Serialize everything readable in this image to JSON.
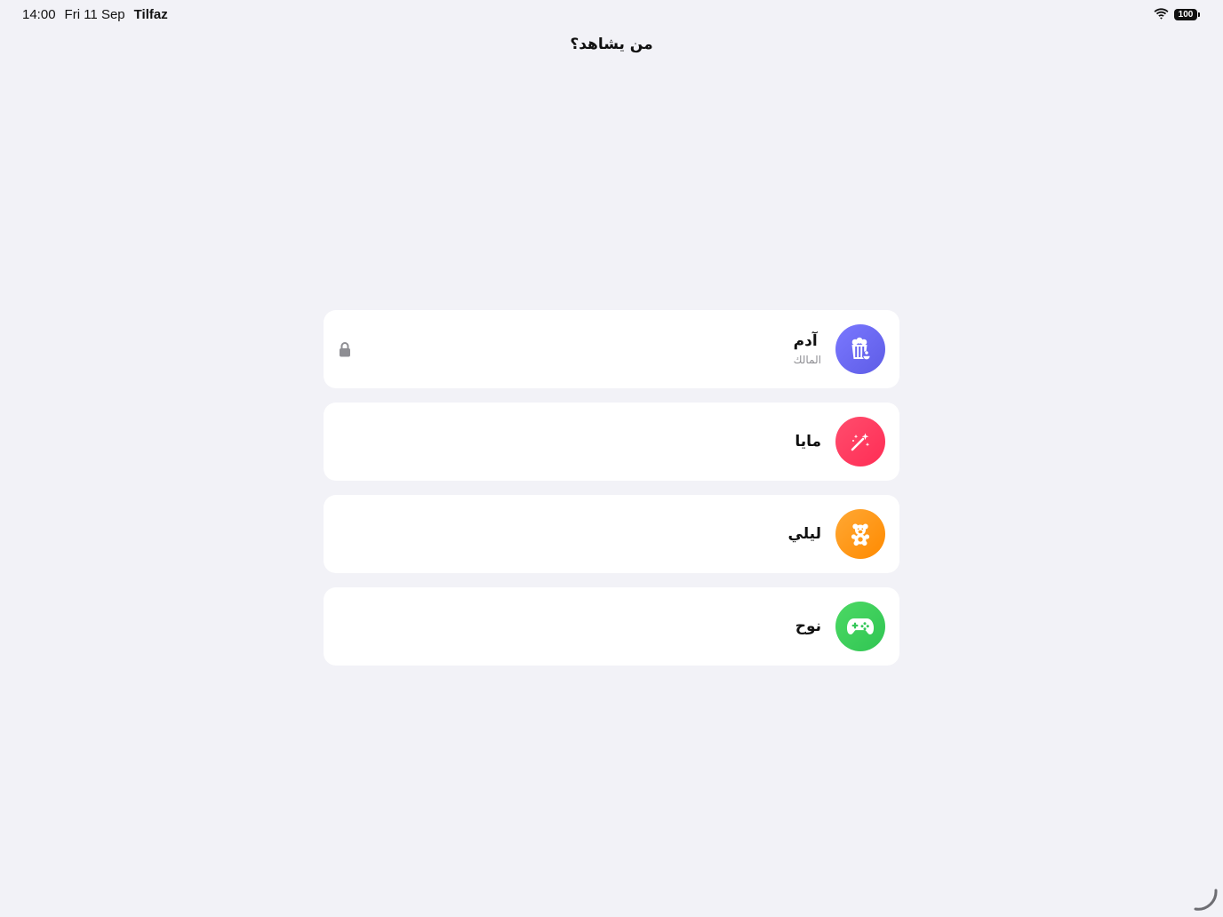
{
  "status_bar": {
    "time": "14:00",
    "date": "Fri 11 Sep",
    "app_name": "Tilfaz",
    "battery_level": "100"
  },
  "header": {
    "title": "من يشاهد؟"
  },
  "profiles": [
    {
      "name": "آدم",
      "role": "المالك",
      "icon": "popcorn-icon",
      "color": "#5e5ce6",
      "locked": true
    },
    {
      "name": "مايا",
      "icon": "magic-wand-icon",
      "color": "#ff2d55"
    },
    {
      "name": "ليلي",
      "icon": "teddy-bear-icon",
      "color": "#ff9500"
    },
    {
      "name": "نوح",
      "icon": "gamepad-icon",
      "color": "#34c759"
    }
  ]
}
